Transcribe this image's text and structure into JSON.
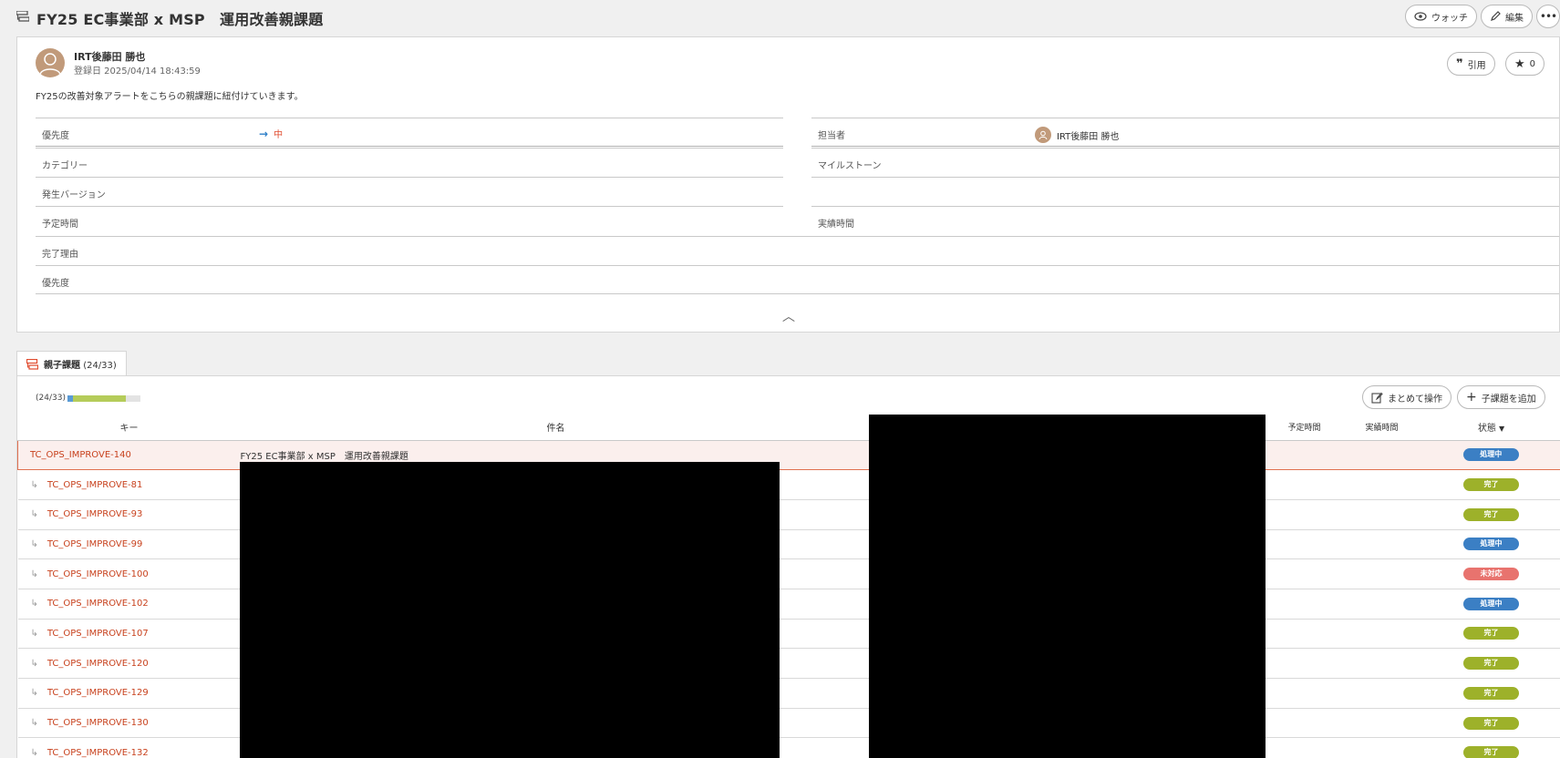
{
  "header": {
    "title": "FY25 EC事業部 x MSP　運用改善親課題",
    "watch_label": "ウォッチ",
    "edit_label": "編集"
  },
  "issue": {
    "author": "IRT後藤田 勝也",
    "created": "登録日  2025/04/14 18:43:59",
    "quote_label": "引用",
    "star_count": "0",
    "description": "FY25の改善対象アラートをこちらの親課題に紐付けていきます。"
  },
  "fields": {
    "priority_label": "優先度",
    "priority_value": "中",
    "assignee_label": "担当者",
    "assignee_value": "IRT後藤田 勝也",
    "category_label": "カテゴリー",
    "milestone_label": "マイルストーン",
    "version_label": "発生バージョン",
    "estimated_label": "予定時間",
    "actual_label": "実績時間",
    "resolution_label": "完了理由",
    "priority2_label": "優先度"
  },
  "subtasks": {
    "tab_label": "親子課題",
    "tab_count": "(24/33)",
    "progress_text": "(24/33)",
    "progress_done_fraction": 0.727,
    "progress_inprogress_fraction": 0.273,
    "bulk_label": "まとめて操作",
    "add_label": "子課題を追加",
    "columns": {
      "key": "キー",
      "subject": "件名",
      "estimated": "予定時間",
      "actual": "実績時間",
      "status": "状態"
    },
    "parent": {
      "key": "TC_OPS_IMPROVE-140",
      "subject": "FY25 EC事業部 x MSP　運用改善親課題",
      "status": "処理中"
    },
    "rows": [
      {
        "key": "TC_OPS_IMPROVE-81",
        "status": "完了"
      },
      {
        "key": "TC_OPS_IMPROVE-93",
        "status": "完了"
      },
      {
        "key": "TC_OPS_IMPROVE-99",
        "status": "処理中"
      },
      {
        "key": "TC_OPS_IMPROVE-100",
        "status": "未対応"
      },
      {
        "key": "TC_OPS_IMPROVE-102",
        "status": "処理中"
      },
      {
        "key": "TC_OPS_IMPROVE-107",
        "status": "完了"
      },
      {
        "key": "TC_OPS_IMPROVE-120",
        "status": "完了"
      },
      {
        "key": "TC_OPS_IMPROVE-129",
        "status": "完了"
      },
      {
        "key": "TC_OPS_IMPROVE-130",
        "status": "完了"
      },
      {
        "key": "TC_OPS_IMPROVE-132",
        "status": "完了"
      }
    ]
  },
  "colors": {
    "accent": "#c8421e",
    "status_in_progress": "#3b7fc4",
    "status_done": "#9db12a",
    "status_open": "#e8736e"
  }
}
